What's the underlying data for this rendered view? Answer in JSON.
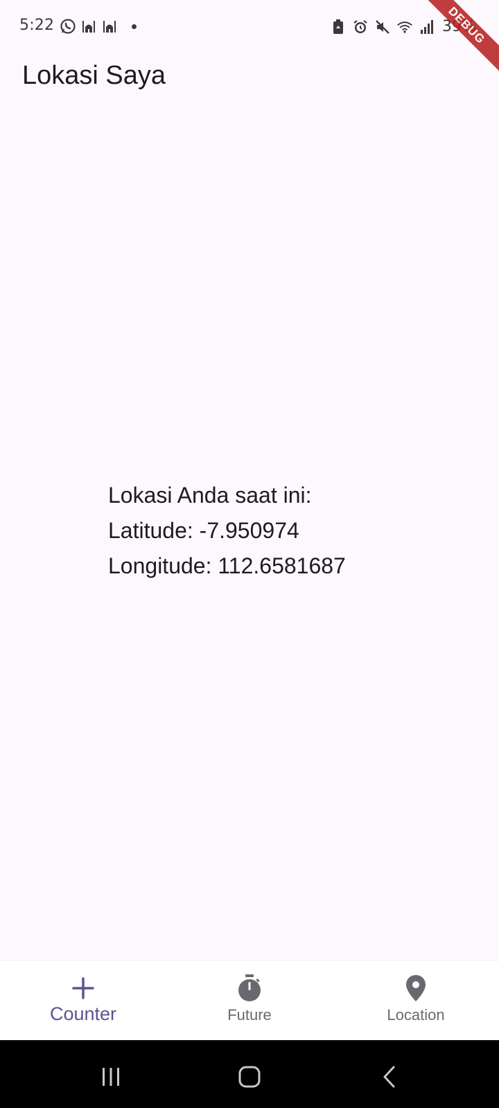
{
  "status_bar": {
    "time": "5:22",
    "left_icons": [
      "whatsapp-icon",
      "mosque-icon",
      "mosque-icon"
    ],
    "right_icons": [
      "battery-saver-icon",
      "alarm-icon",
      "mute-icon",
      "wifi-icon",
      "signal-icon"
    ],
    "battery_percent": "39%"
  },
  "debug_banner": "DEBUG",
  "app_bar": {
    "title": "Lokasi Saya"
  },
  "location": {
    "heading": "Lokasi Anda saat ini:",
    "latitude_text": "Latitude: -7.950974",
    "longitude_text": "Longitude: 112.6581687"
  },
  "bottom_nav": {
    "items": [
      {
        "label": "Counter",
        "icon": "add-icon",
        "active": true
      },
      {
        "label": "Future",
        "icon": "timer-icon",
        "active": false
      },
      {
        "label": "Location",
        "icon": "location-pin-icon",
        "active": false
      }
    ]
  },
  "colors": {
    "background": "#fdf8fd",
    "active_nav": "#5e5193",
    "inactive_nav": "#6b6770",
    "debug_banner": "#b71c1c"
  }
}
